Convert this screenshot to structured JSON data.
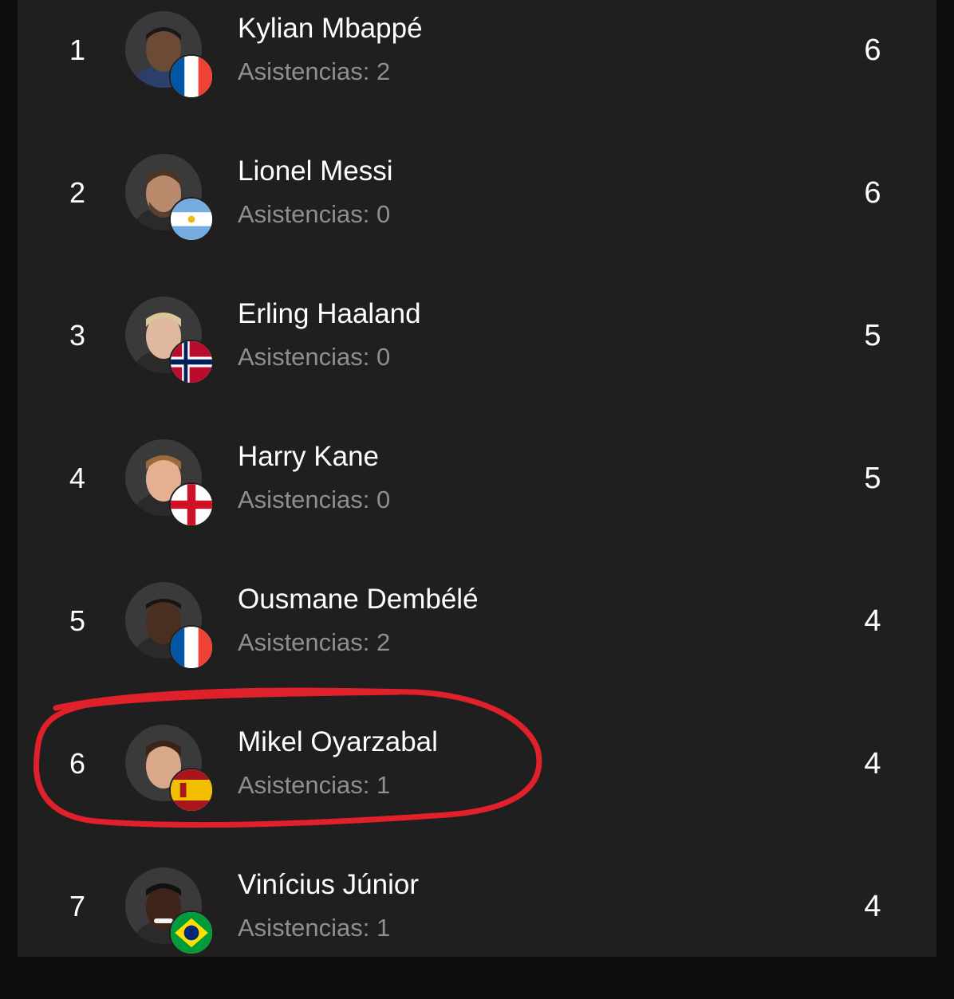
{
  "list": {
    "assists_prefix": "Asistencias:",
    "players": [
      {
        "rank": "1",
        "name": "Kylian Mbappé",
        "assists": "Asistencias: 2",
        "goals": "6",
        "flag": "france-flag-icon"
      },
      {
        "rank": "2",
        "name": "Lionel Messi",
        "assists": "Asistencias: 0",
        "goals": "6",
        "flag": "argentina-flag-icon"
      },
      {
        "rank": "3",
        "name": "Erling Haaland",
        "assists": "Asistencias: 0",
        "goals": "5",
        "flag": "norway-flag-icon"
      },
      {
        "rank": "4",
        "name": "Harry Kane",
        "assists": "Asistencias: 0",
        "goals": "5",
        "flag": "england-flag-icon"
      },
      {
        "rank": "5",
        "name": "Ousmane Dembélé",
        "assists": "Asistencias: 2",
        "goals": "4",
        "flag": "france-flag-icon"
      },
      {
        "rank": "6",
        "name": "Mikel Oyarzabal",
        "assists": "Asistencias: 1",
        "goals": "4",
        "flag": "spain-flag-icon",
        "highlighted": true
      },
      {
        "rank": "7",
        "name": "Vinícius Júnior",
        "assists": "Asistencias: 1",
        "goals": "4",
        "flag": "brazil-flag-icon"
      }
    ]
  },
  "colors": {
    "background": "#1f1f1f",
    "text_primary": "#ffffff",
    "text_secondary": "#8e8e93",
    "highlight_stroke": "#e0202a"
  }
}
